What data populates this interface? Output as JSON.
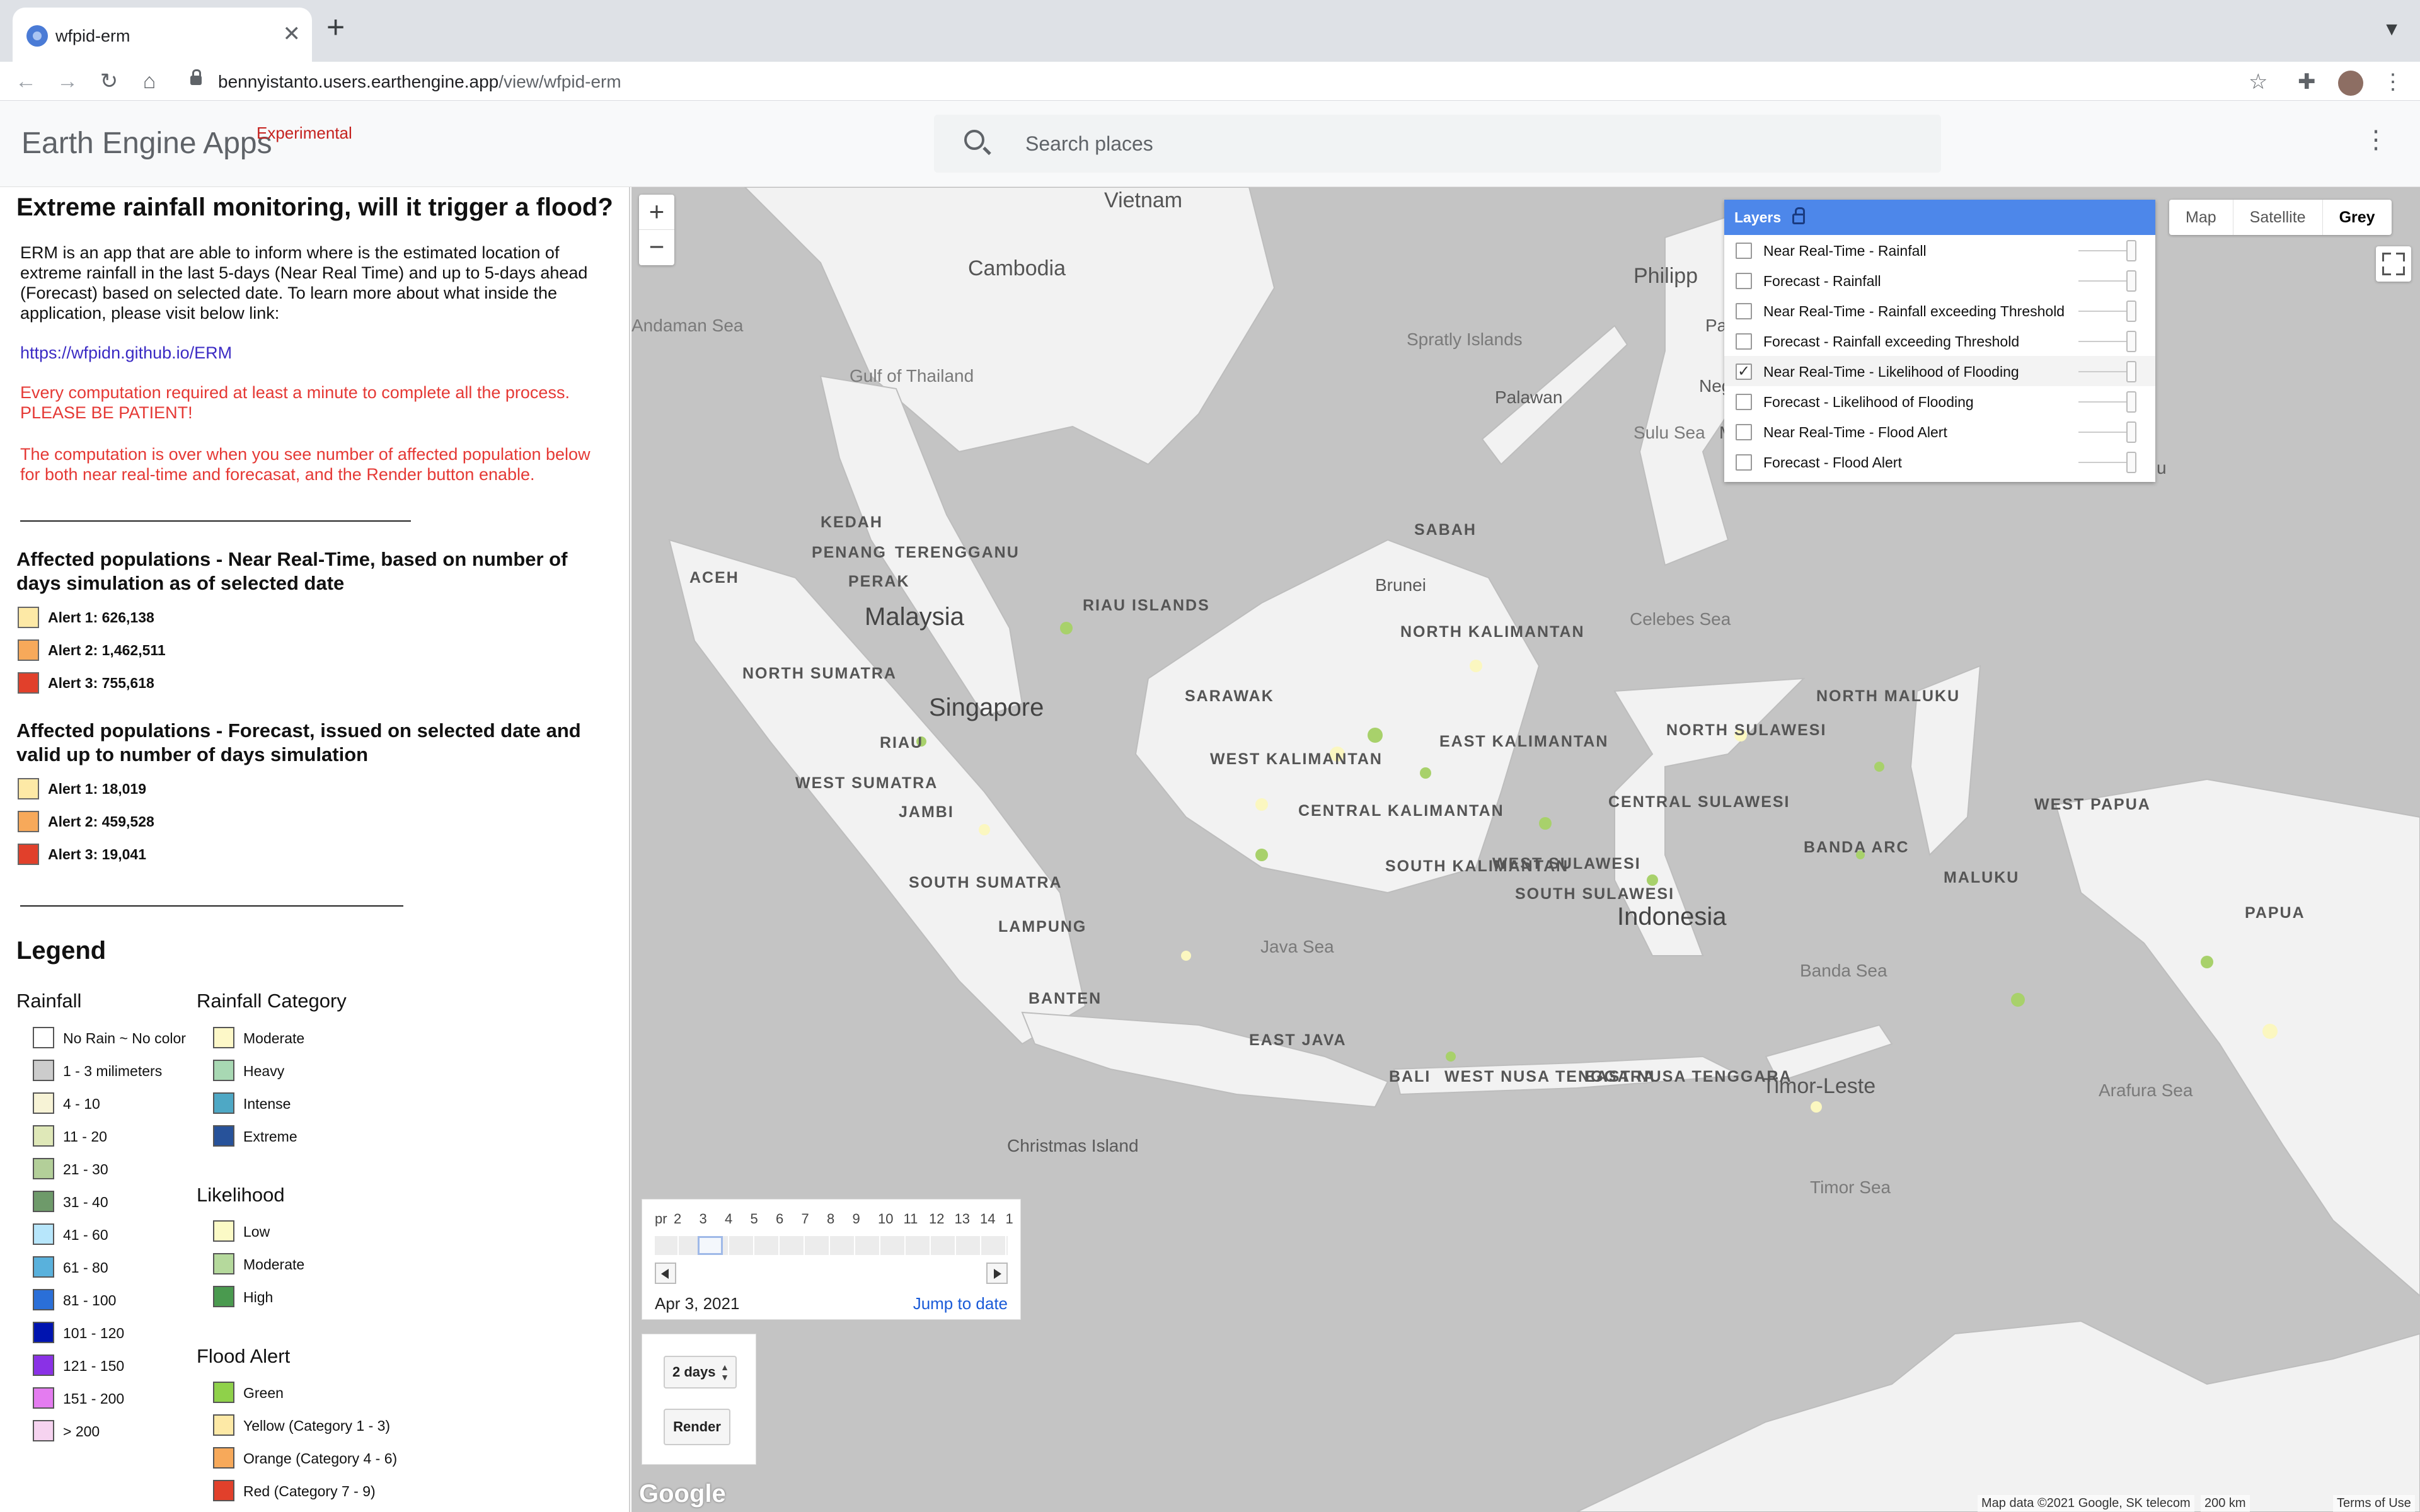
{
  "browser": {
    "tab_title": "wfpid-erm",
    "url_host": "bennyistanto.users.earthengine.app",
    "url_path": "/view/wfpid-erm"
  },
  "header": {
    "brand": "Earth Engine Apps",
    "badge": "Experimental",
    "search_placeholder": "Search places"
  },
  "panel": {
    "title": "Extreme rainfall monitoring, will it trigger a flood?",
    "intro": "ERM is an app that are able to inform where is the estimated location of extreme rainfall in the last 5-days (Near Real Time) and up to 5-days ahead (Forecast) based on selected date. To learn more about what inside the application, please visit below link:",
    "link": "https://wfpidn.github.io/ERM",
    "warning_1": "Every computation required at least a minute to complete all the process. PLEASE BE PATIENT!",
    "warning_2": "The computation is over when you see number of affected population below for both near real-time and forecasat, and the Render button enable.",
    "nrt_heading": "Affected populations - Near Real-Time, based on number of days simulation as of selected date",
    "nrt_alerts": [
      "Alert 1: 626,138",
      "Alert 2: 1,462,511",
      "Alert 3: 755,618"
    ],
    "fc_heading": "Affected populations - Forecast, issued on selected date and valid up to number of days simulation",
    "fc_alerts": [
      "Alert 1: 18,019",
      "Alert 2: 459,528",
      "Alert 3: 19,041"
    ],
    "alert_colors": [
      "#fde9a6",
      "#f7a95a",
      "#e1402b"
    ]
  },
  "legend": {
    "title": "Legend",
    "rainfall": {
      "title": "Rainfall",
      "items": [
        {
          "label": "No Rain ~ No color",
          "color": "#ffffff"
        },
        {
          "label": "1 - 3 milimeters",
          "color": "#cccccc"
        },
        {
          "label": "4 - 10",
          "color": "#f7f3d6"
        },
        {
          "label": "11 - 20",
          "color": "#dfe8b8"
        },
        {
          "label": "21 - 30",
          "color": "#b3cf99"
        },
        {
          "label": "31 - 40",
          "color": "#6e9a6a"
        },
        {
          "label": "41 - 60",
          "color": "#b7e6fb"
        },
        {
          "label": "61 - 80",
          "color": "#59b1dc"
        },
        {
          "label": "81 - 100",
          "color": "#2a6fd8"
        },
        {
          "label": "101 - 120",
          "color": "#0014b0"
        },
        {
          "label": "121 - 150",
          "color": "#8a31e6"
        },
        {
          "label": "151 - 200",
          "color": "#e47cf0"
        },
        {
          "label": "> 200",
          "color": "#f6d3f0"
        }
      ]
    },
    "category": {
      "title": "Rainfall Category",
      "items": [
        {
          "label": "Moderate",
          "color": "#fdf8c8"
        },
        {
          "label": "Heavy",
          "color": "#a8d8b3"
        },
        {
          "label": "Intense",
          "color": "#4ea8c5"
        },
        {
          "label": "Extreme",
          "color": "#27529a"
        }
      ]
    },
    "likelihood": {
      "title": "Likelihood",
      "items": [
        {
          "label": "Low",
          "color": "#fbfac6"
        },
        {
          "label": "Moderate",
          "color": "#b5d99c"
        },
        {
          "label": "High",
          "color": "#4a9a4f"
        }
      ]
    },
    "flood_alert": {
      "title": "Flood Alert",
      "items": [
        {
          "label": "Green",
          "color": "#8fd14a"
        },
        {
          "label": "Yellow (Category 1 - 3)",
          "color": "#fde9a6"
        },
        {
          "label": "Orange (Category 4 - 6)",
          "color": "#f7a95a"
        },
        {
          "label": "Red (Category 7 - 9)",
          "color": "#e1402b"
        }
      ]
    }
  },
  "map": {
    "zoom_in": "+",
    "zoom_out": "−",
    "map_types": [
      "Map",
      "Satellite",
      "Grey"
    ],
    "active_map_type": "Grey",
    "layers_title": "Layers",
    "layers": [
      {
        "label": "Near Real-Time - Rainfall",
        "checked": false
      },
      {
        "label": "Forecast - Rainfall",
        "checked": false
      },
      {
        "label": "Near Real-Time - Rainfall exceeding Threshold",
        "checked": false
      },
      {
        "label": "Forecast - Rainfall exceeding Threshold",
        "checked": false
      },
      {
        "label": "Near Real-Time - Likelihood of Flooding",
        "checked": true
      },
      {
        "label": "Forecast - Likelihood of Flooding",
        "checked": false
      },
      {
        "label": "Near Real-Time - Flood Alert",
        "checked": false
      },
      {
        "label": "Forecast - Flood Alert",
        "checked": false
      }
    ],
    "place_labels": [
      "Vietnam",
      "Cambodia",
      "Philipp",
      "Andaman Sea",
      "Gulf of Thailand",
      "Spratly Islands",
      "Palawan",
      "Sulu Sea",
      "Panay",
      "Negro",
      "Minda",
      "KEDAH",
      "PENANG",
      "TERENGGANU",
      "PERAK",
      "ACEH",
      "SABAH",
      "Malaysia",
      "Brunei",
      "RIAU ISLANDS",
      "NORTH KALIMANTAN",
      "Celebes Sea",
      "NORTH SUMATRA",
      "Singapore",
      "SARAWAK",
      "NORTH MALUKU",
      "RIAU",
      "EAST KALIMANTAN",
      "NORTH SULAWESI",
      "WEST KALIMANTAN",
      "WEST SUMATRA",
      "JAMBI",
      "CENTRAL KALIMANTAN",
      "CENTRAL SULAWESI",
      "WEST PAPUA",
      "BANDA ARC",
      "SOUTH KALIMANTAN",
      "WEST SULAWESI",
      "SOUTH SUMATRA",
      "SOUTH SULAWESI",
      "MALUKU",
      "Indonesia",
      "PAPUA",
      "LAMPUNG",
      "Java Sea",
      "Banda Sea",
      "BANTEN",
      "EAST JAVA",
      "BALI",
      "WEST NUSA TENGGARA",
      "EAST NUSA TENGGARA",
      "Timor-Leste",
      "Arafura Sea",
      "Christmas Island",
      "Timor Sea",
      "u"
    ],
    "date_ticks": [
      "pr",
      "2",
      "3",
      "4",
      "5",
      "6",
      "7",
      "8",
      "9",
      "10",
      "11",
      "12",
      "13",
      "14",
      "1"
    ],
    "selected_date": "Apr 3, 2021",
    "jump_label": "Jump to date",
    "days_option": "2 days",
    "render_label": "Render",
    "google_logo": "Google",
    "attribution": "Map data ©2021 Google, SK telecom",
    "scale": "200 km",
    "terms": "Terms of Use"
  }
}
